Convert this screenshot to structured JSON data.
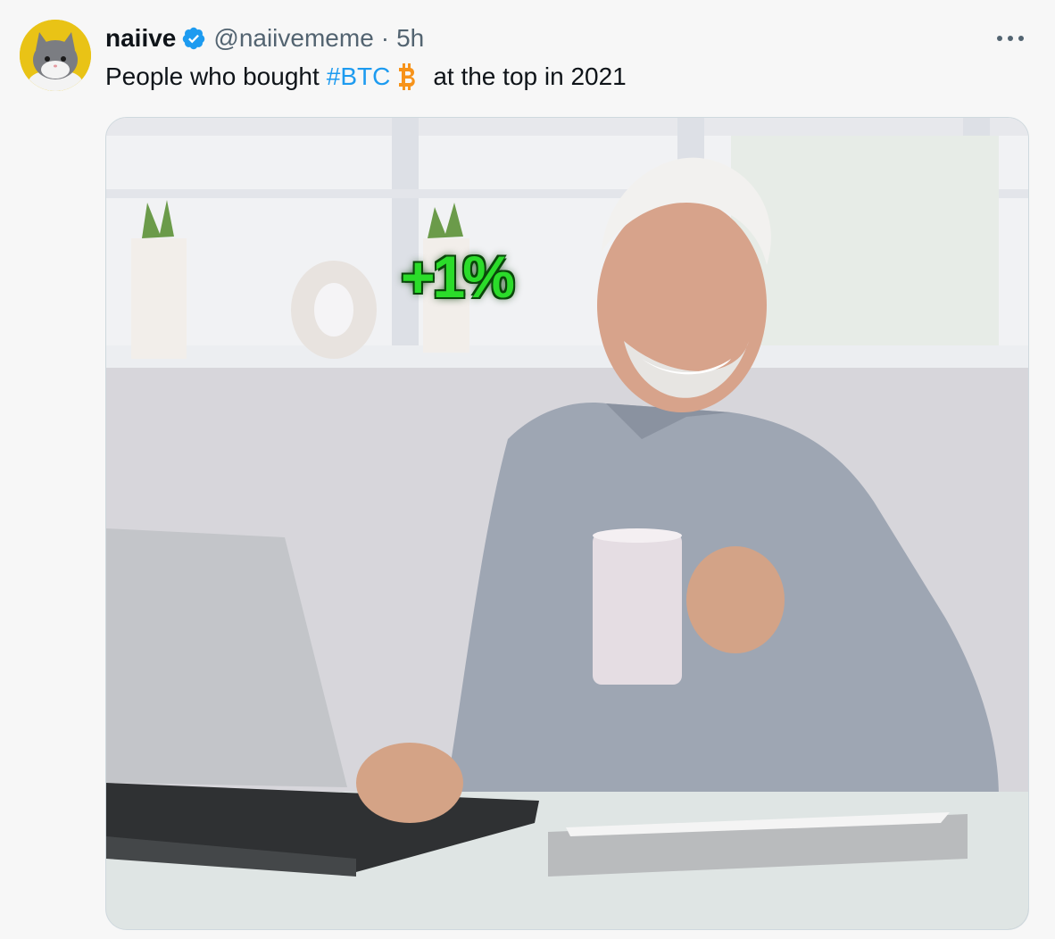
{
  "tweet": {
    "author_name": "naiive",
    "handle": "@naiivememe",
    "separator": "·",
    "time": "5h",
    "more_icon": "more-horizontal-icon",
    "text_before": "People who bought",
    "hashtag": "#BTC",
    "text_after": "at the top in 2021",
    "verified_icon": "verified-badge-icon",
    "bitcoin_icon": "bitcoin-icon",
    "colors": {
      "hashtag": "#1d9bf0",
      "verified": "#1d9bf0",
      "bitcoin": "#f7931a"
    }
  },
  "media": {
    "overlay_text": "+1%",
    "overlay_color": "#2bdc2a"
  }
}
